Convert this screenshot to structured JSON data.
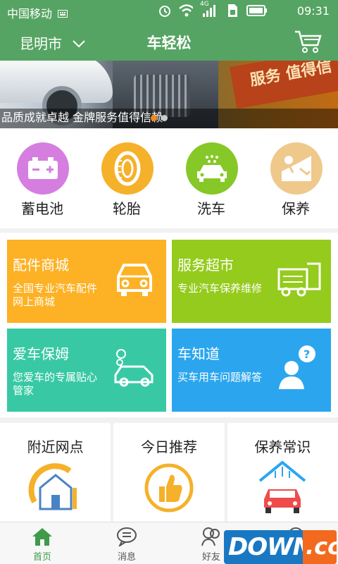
{
  "status_bar": {
    "carrier": "中国移动",
    "time": "09:31",
    "icons": [
      "keyboard-icon",
      "alarm-icon",
      "wifi-icon",
      "signal-4g-icon",
      "sim-icon",
      "battery-icon"
    ],
    "network_label": "4G"
  },
  "header": {
    "city": "昆明市",
    "title": "车轻松",
    "icons": [
      "chevron-down-icon",
      "cart-icon"
    ]
  },
  "banner": {
    "caption": "品质成就卓越 金牌服务值得信赖",
    "slogan": "服务 值得信",
    "slide_count": 2,
    "active_slide": 1
  },
  "categories": [
    {
      "label": "蓄电池",
      "icon": "battery-car-icon",
      "color": "#d57ee0"
    },
    {
      "label": "轮胎",
      "icon": "tire-icon",
      "color": "#f5b12a"
    },
    {
      "label": "洗车",
      "icon": "car-wash-icon",
      "color": "#86c827"
    },
    {
      "label": "保养",
      "icon": "maintenance-icon",
      "color": "#efc98c"
    }
  ],
  "tiles": [
    {
      "title": "配件商城",
      "desc": "全国专业汽车配件网上商城",
      "icon": "car-front-icon",
      "color": "#fdb124"
    },
    {
      "title": "服务超市",
      "desc": "专业汽车保养维修",
      "icon": "service-truck-icon",
      "color": "#94cb1c"
    },
    {
      "title": "爱车保姆",
      "desc": "您爱车的专属贴心管家",
      "icon": "car-care-icon",
      "color": "#38c9a4"
    },
    {
      "title": "车知道",
      "desc": "买车用车问题解答",
      "icon": "question-person-icon",
      "color": "#2ba6ee"
    }
  ],
  "cards": [
    {
      "title": "附近网点",
      "icon": "nearby-house-icon"
    },
    {
      "title": "今日推荐",
      "icon": "thumbs-up-icon"
    },
    {
      "title": "保养常识",
      "icon": "car-wash-station-icon"
    }
  ],
  "bottom_nav": [
    {
      "label": "首页",
      "icon": "home-icon",
      "active": true
    },
    {
      "label": "消息",
      "icon": "message-icon",
      "active": false
    },
    {
      "label": "好友",
      "icon": "friends-icon",
      "active": false
    },
    {
      "label": "",
      "icon": "more-icon",
      "active": false
    }
  ],
  "watermark": {
    "text": "DOWN",
    "tld": ".cc"
  },
  "colors": {
    "primary": "#56a463",
    "nav_active": "#3d9b4a"
  }
}
